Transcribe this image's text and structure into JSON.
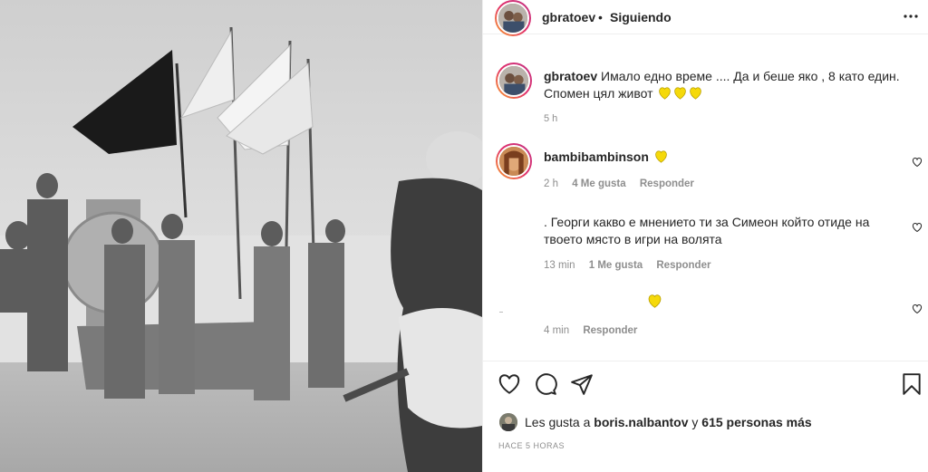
{
  "header": {
    "username": "gbratoev",
    "separator": "•",
    "follow_state": "Siguiendo"
  },
  "caption": {
    "username": "gbratoev",
    "text": "Имало едно време .... Да и беше яко , 8 като един. Спомен цял живот",
    "emoji": [
      "yellow-heart",
      "yellow-heart",
      "yellow-heart"
    ],
    "time": "5 h"
  },
  "comments": [
    {
      "username": "bambibambinson",
      "emoji": "yellow-heart",
      "time": "2 h",
      "likes": "4 Me gusta",
      "reply": "Responder"
    },
    {
      "text": ". Георги какво е мнението ти за Симеон който отиде на твоето място в игри на волята",
      "time": "13 min",
      "likes": "1 Me gusta",
      "reply": "Responder"
    },
    {
      "emoji": "yellow-heart",
      "time": "4 min",
      "reply": "Responder"
    }
  ],
  "likes_line": {
    "prefix": "Les gusta a",
    "user": "boris.nalbantov",
    "middle": "y",
    "others": "615 personas más"
  },
  "posted": "HACE 5 HORAS",
  "colors": {
    "heart": "#f5d90a",
    "muted": "#8e8e8e",
    "text": "#262626"
  }
}
